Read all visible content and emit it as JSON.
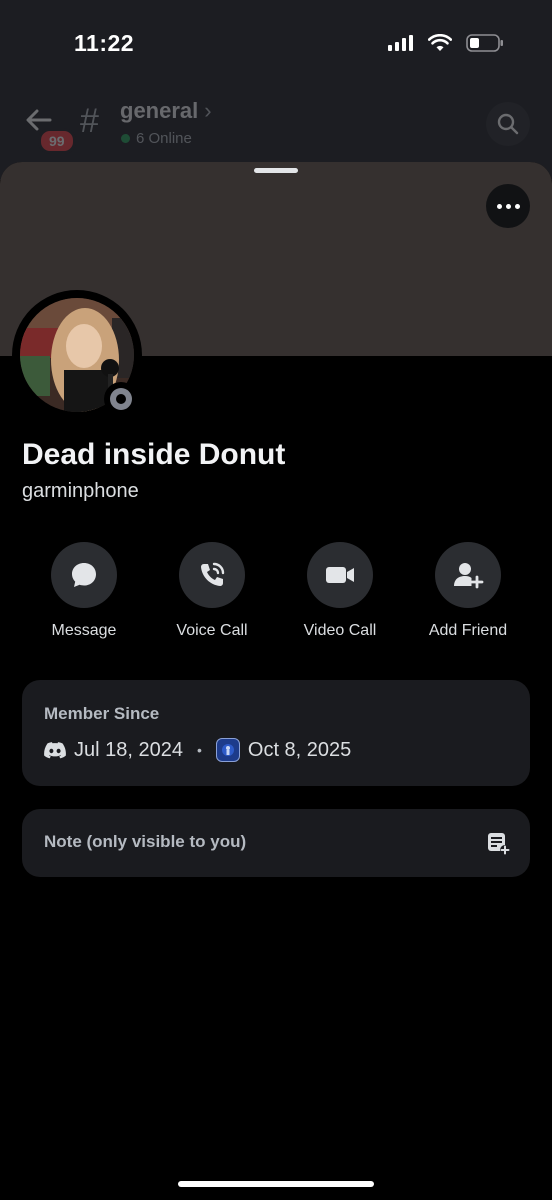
{
  "status_bar": {
    "time": "11:22"
  },
  "channel": {
    "name": "general",
    "online": "6 Online",
    "unread_badge": "99"
  },
  "profile": {
    "display_name": "Dead inside Donut",
    "username": "garminphone"
  },
  "actions": [
    {
      "label": "Message",
      "icon": "chat-bubble-icon"
    },
    {
      "label": "Voice Call",
      "icon": "phone-icon"
    },
    {
      "label": "Video Call",
      "icon": "video-camera-icon"
    },
    {
      "label": "Add Friend",
      "icon": "add-friend-icon"
    }
  ],
  "member_since": {
    "title": "Member Since",
    "discord_date": "Jul 18, 2024",
    "separator": "•",
    "server_date": "Oct 8, 2025"
  },
  "note": {
    "placeholder": "Note (only visible to you)"
  },
  "colors": {
    "background": "#000000",
    "card": "#1a1b1f",
    "button": "#2b2d31",
    "banner": "#35302f",
    "online_green": "#23a55a",
    "badge_red": "#f23f43"
  }
}
